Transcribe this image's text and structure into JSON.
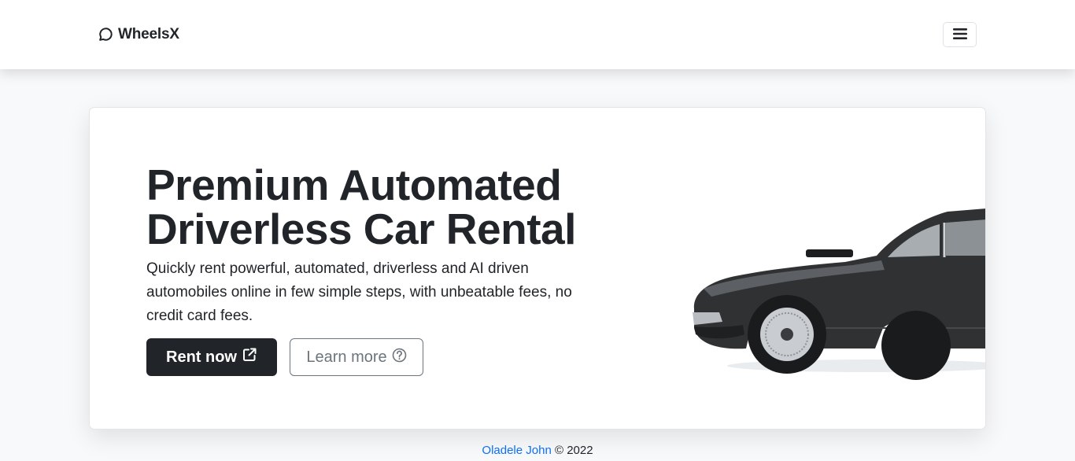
{
  "navbar": {
    "brand_name": "WheelsX",
    "brand_icon": "chat-circle-icon",
    "menu_icon": "hamburger-menu-icon"
  },
  "hero": {
    "title_line1": "Premium Automated",
    "title_line2": "Driverless Car Rental",
    "description": "Quickly rent powerful, automated, driverless and AI driven automobiles online in few simple steps, with unbeatable fees, no credit card fees.",
    "rent_button_label": "Rent now",
    "rent_button_icon": "external-link-icon",
    "learn_button_label": "Learn more",
    "learn_button_icon": "question-circle-icon",
    "image_subject": "black-classic-car"
  },
  "footer": {
    "author": "Oladele John",
    "copyright": "© 2022"
  },
  "colors": {
    "primary_dark": "#212529",
    "link": "#0d6efd",
    "background": "#f8f9fa"
  }
}
